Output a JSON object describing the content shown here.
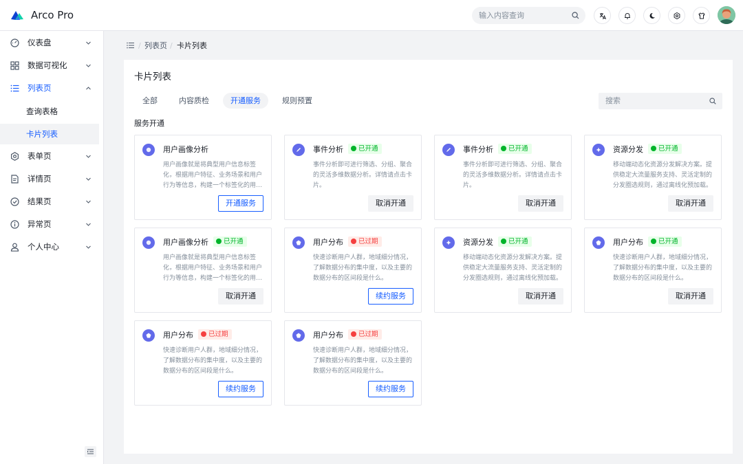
{
  "app": {
    "title": "Arco Pro"
  },
  "header": {
    "search_placeholder": "输入内容查询",
    "actions": [
      "translate-icon",
      "bell-icon",
      "moon-icon",
      "settings-icon",
      "tshirt-icon"
    ]
  },
  "sidebar": {
    "items": [
      {
        "label": "仪表盘",
        "icon": "dashboard-icon",
        "expanded": false
      },
      {
        "label": "数据可视化",
        "icon": "grid-icon",
        "expanded": false
      },
      {
        "label": "列表页",
        "icon": "list-icon",
        "expanded": true,
        "children": [
          {
            "label": "查询表格"
          },
          {
            "label": "卡片列表",
            "selected": true
          }
        ]
      },
      {
        "label": "表单页",
        "icon": "gear-icon",
        "expanded": false
      },
      {
        "label": "详情页",
        "icon": "file-icon",
        "expanded": false
      },
      {
        "label": "结果页",
        "icon": "check-circle-icon",
        "expanded": false
      },
      {
        "label": "异常页",
        "icon": "exclamation-circle-icon",
        "expanded": false
      },
      {
        "label": "个人中心",
        "icon": "user-icon",
        "expanded": false
      }
    ]
  },
  "breadcrumb": [
    "列表页",
    "卡片列表"
  ],
  "main": {
    "title": "卡片列表",
    "tabs": [
      {
        "label": "全部",
        "active": false
      },
      {
        "label": "内容质检",
        "active": false
      },
      {
        "label": "开通服务",
        "active": true
      },
      {
        "label": "规则预置",
        "active": false
      }
    ],
    "search_placeholder": "搜索",
    "section_title": "服务开通",
    "cards": [
      {
        "title": "用户画像分析",
        "icon": "user-portrait-icon",
        "status": "",
        "status_type": "",
        "desc": "用户画像就是将典型用户信息标签化，根据用户特征、业务场景和用户行为等信息，构建一个标签化的用…",
        "button": "开通服务",
        "button_style": "primary"
      },
      {
        "title": "事件分析",
        "icon": "pen-icon",
        "status": "已开通",
        "status_type": "ok",
        "desc": "事件分析即可进行筛选、分组、聚合的灵活多维数据分析。详情请点击卡片。",
        "button": "取消开通",
        "button_style": "secondary"
      },
      {
        "title": "事件分析",
        "icon": "pen-icon",
        "status": "已开通",
        "status_type": "ok",
        "desc": "事件分析即可进行筛选、分组、聚合的灵活多维数据分析。详情请点击卡片。",
        "button": "取消开通",
        "button_style": "secondary"
      },
      {
        "title": "资源分发",
        "icon": "share-icon",
        "status": "已开通",
        "status_type": "ok",
        "desc": "移动端动态化资源分发解决方案。提供稳定大流量服务支持、灵活定制的分发圈选规则，通过离线化预加载。",
        "button": "取消开通",
        "button_style": "secondary"
      },
      {
        "title": "用户画像分析",
        "icon": "user-portrait-icon",
        "status": "已开通",
        "status_type": "ok",
        "desc": "用户画像就是将典型用户信息标签化，根据用户特征、业务场景和用户行为等信息，构建一个标签化的用…",
        "button": "取消开通",
        "button_style": "secondary"
      },
      {
        "title": "用户分布",
        "icon": "distribution-icon",
        "status": "已过期",
        "status_type": "exp",
        "desc": "快速诊断用户人群，地域细分情况，了解数据分布的集中度，以及主要的数据分布的区间段是什么。",
        "button": "续约服务",
        "button_style": "primary"
      },
      {
        "title": "资源分发",
        "icon": "share-icon",
        "status": "已开通",
        "status_type": "ok",
        "desc": "移动端动态化资源分发解决方案。提供稳定大流量服务支持、灵活定制的分发圈选规则，通过离线化预加载。",
        "button": "取消开通",
        "button_style": "secondary"
      },
      {
        "title": "用户分布",
        "icon": "distribution-icon",
        "status": "已开通",
        "status_type": "ok",
        "desc": "快速诊断用户人群，地域细分情况，了解数据分布的集中度，以及主要的数据分布的区间段是什么。",
        "button": "取消开通",
        "button_style": "secondary"
      },
      {
        "title": "用户分布",
        "icon": "distribution-icon",
        "status": "已过期",
        "status_type": "exp",
        "desc": "快速诊断用户人群，地域细分情况，了解数据分布的集中度，以及主要的数据分布的区间段是什么。",
        "button": "续约服务",
        "button_style": "primary"
      },
      {
        "title": "用户分布",
        "icon": "distribution-icon",
        "status": "已过期",
        "status_type": "exp",
        "desc": "快速诊断用户人群，地域细分情况，了解数据分布的集中度，以及主要的数据分布的区间段是什么。",
        "button": "续约服务",
        "button_style": "primary"
      }
    ]
  },
  "colors": {
    "primary": "#165dff",
    "success": "#00b42a",
    "danger": "#f53f3f",
    "card_icon": "#626aea"
  }
}
